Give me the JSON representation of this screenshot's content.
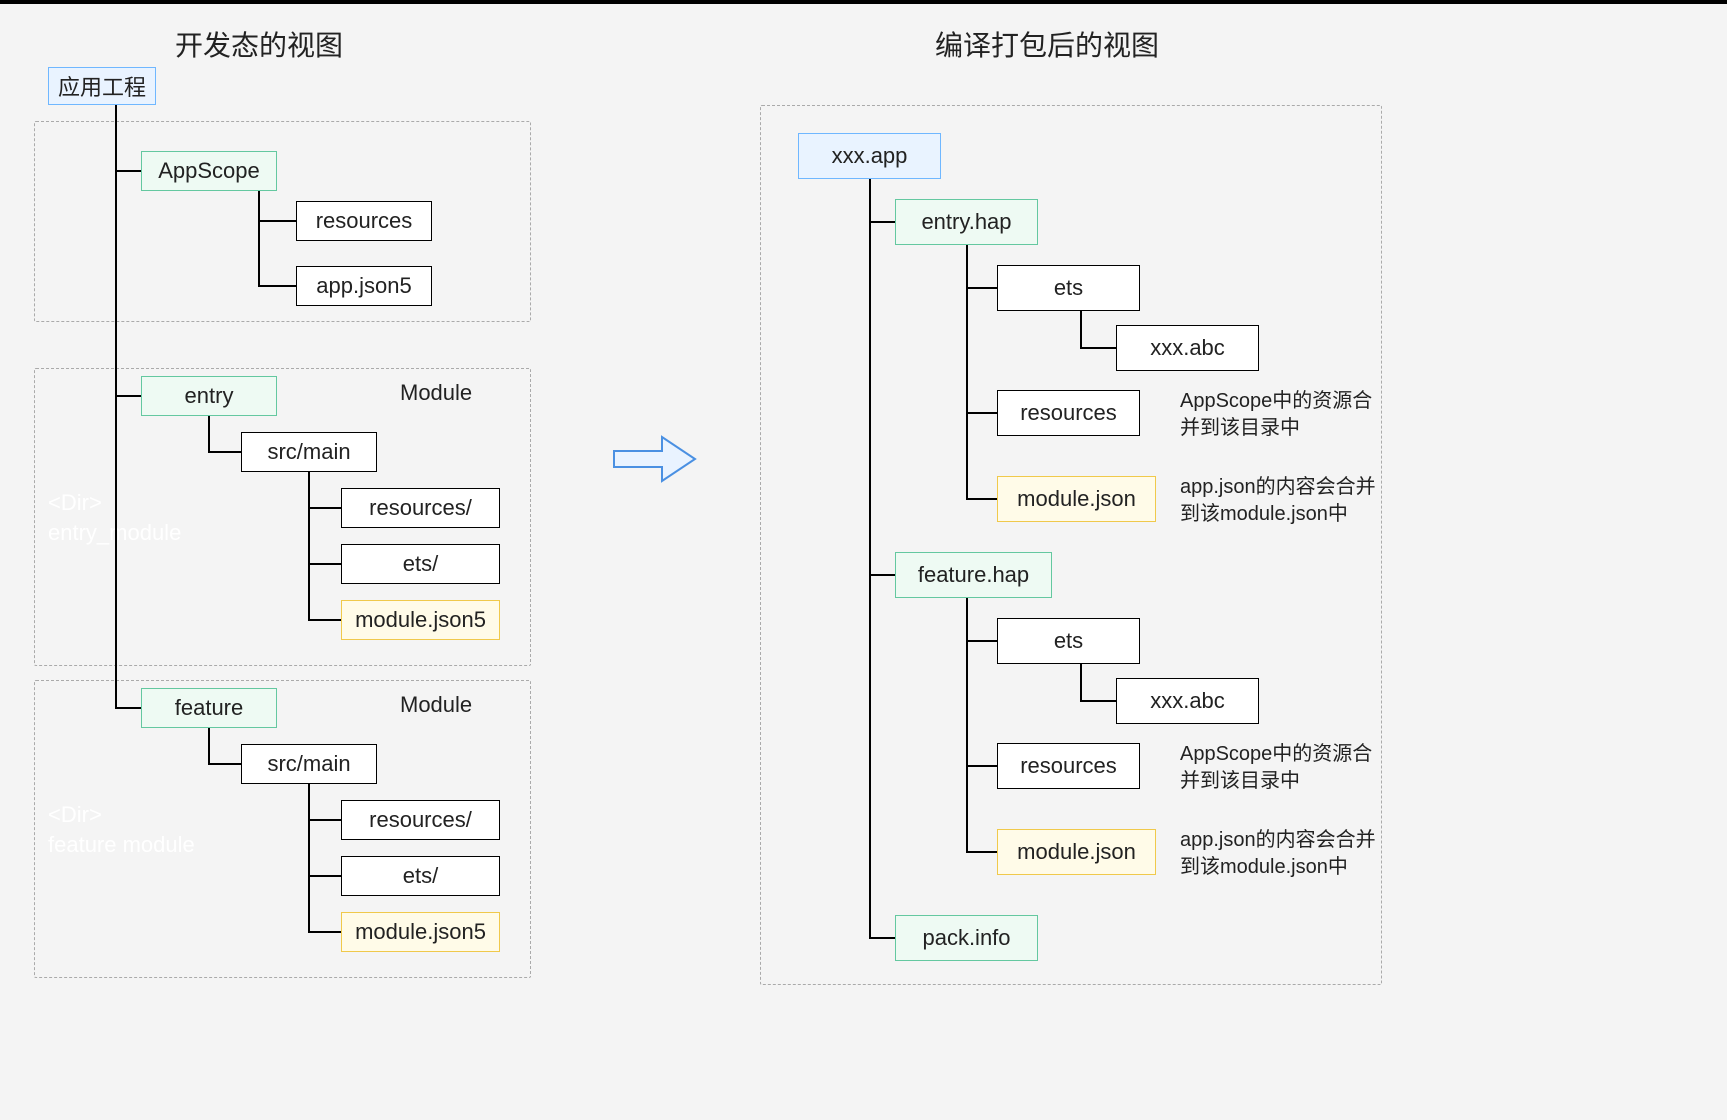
{
  "left": {
    "title": "开发态的视图",
    "root": "应用工程",
    "watermark_entry": "<Dir>\nentry_module",
    "watermark_feature": "<Dir>\nfeature module",
    "module_label": "Module",
    "appscope": {
      "name": "AppScope",
      "children": [
        "resources",
        "app.json5"
      ]
    },
    "modules": [
      {
        "name": "entry",
        "srcmain": "src/main",
        "children": [
          "resources/",
          "ets/",
          "module.json5"
        ]
      },
      {
        "name": "feature",
        "srcmain": "src/main",
        "children": [
          "resources/",
          "ets/",
          "module.json5"
        ]
      }
    ]
  },
  "right": {
    "title": "编译打包后的视图",
    "root": "xxx.app",
    "pack_info": "pack.info",
    "note_resources": "AppScope中的资源合并到该目录中",
    "note_modulejson_entry": "app.json的内容会合并到该module.json中",
    "note_modulejson_feature": "app.json的内容会合并到该module.json中",
    "haps": [
      {
        "name": "entry.hap",
        "ets": "ets",
        "abc": "xxx.abc",
        "resources": "resources",
        "modulejson": "module.json"
      },
      {
        "name": "feature.hap",
        "ets": "ets",
        "abc": "xxx.abc",
        "resources": "resources",
        "modulejson": "module.json"
      }
    ]
  },
  "colors": {
    "blue_border": "#6fb7ff",
    "blue_fill": "#e9f3ff",
    "green_border": "#64c8a0",
    "green_fill": "#eefaf3",
    "black_border": "#000000",
    "orange_border": "#f0c94b",
    "orange_fill": "#fffbe8"
  }
}
